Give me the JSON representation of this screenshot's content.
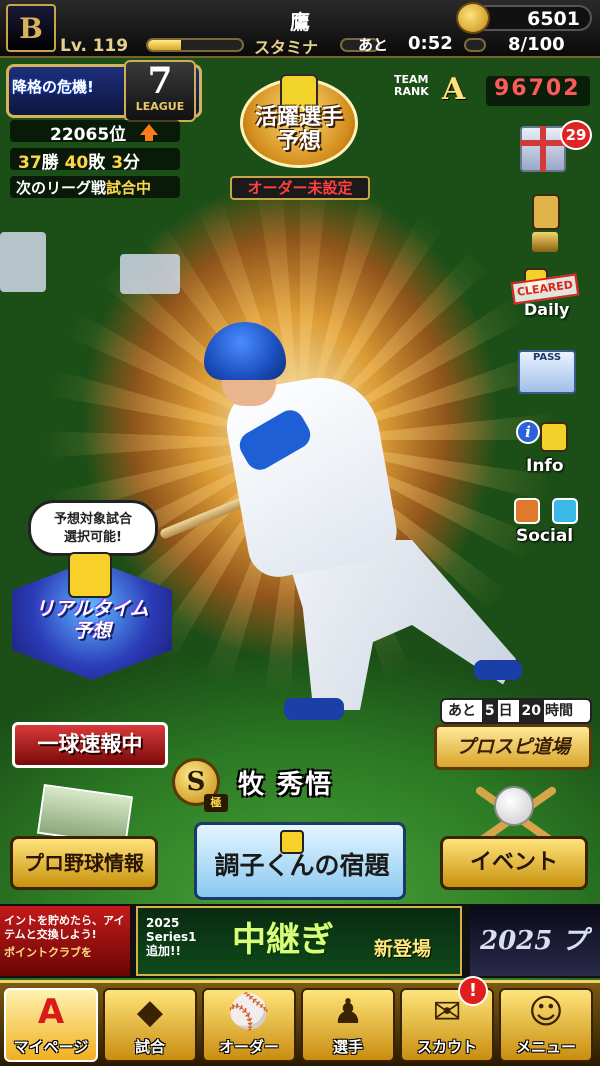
{
  "header": {
    "team_logo": "B",
    "team_name": "鷹",
    "coins": "6501",
    "level_label": "Lv.",
    "level": "119",
    "stamina_label": "スタミナ",
    "stamina_fill": 0.35,
    "time_prefix": "あと",
    "timer": "0:52",
    "stamina_count": "8/100"
  },
  "league": {
    "warning": "降格の危機!",
    "number": "7",
    "word": "LEAGUE",
    "rank": "22065位",
    "wins": "37",
    "wins_unit": "勝",
    "losses": "40",
    "losses_unit": "敗",
    "draws": "3",
    "draws_unit": "分",
    "next_label": "次のリーグ戦",
    "next_status": "試合中"
  },
  "prediction": {
    "title_line1": "活躍選手",
    "title_line2": "予想",
    "order_status": "オーダー未設定"
  },
  "team_rank": {
    "label_line1": "TEAM",
    "label_line2": "RANK",
    "grade": "A",
    "value": "96702"
  },
  "side_menu": {
    "gift_count": "29",
    "cleared_stamp": "CLEARED",
    "daily_label": "Daily",
    "pass_label": "PASS",
    "info_label": "Info",
    "social_label": "Social"
  },
  "realtime": {
    "bubble_line1": "予想対象試合",
    "bubble_line2": "選択可能!",
    "title_line1": "リアルタイム",
    "title_line2": "予想"
  },
  "dojo": {
    "prefix": "あと",
    "days": "5",
    "days_unit": "日",
    "hours": "20",
    "hours_unit": "時間",
    "title": "プロスピ道場"
  },
  "news_button": "一球速報中",
  "player": {
    "rank_letter": "S",
    "rank_sub": "極",
    "name": "牧 秀悟"
  },
  "actions": {
    "pro_info": "プロ野球情報",
    "homework": "調子くんの宿題",
    "event": "イベント"
  },
  "banners": {
    "left_text": "イントを貯めたら、アイテムと交換しよう!",
    "left_sub": "ポイントクラブを",
    "mid_year_line1": "2025",
    "mid_year_line2": "Series1",
    "mid_year_line3": "追加!!",
    "mid_title": "中継ぎ",
    "mid_sub": "新登場",
    "right_text": "2025 プ"
  },
  "nav": {
    "items": [
      {
        "label": "マイページ",
        "glyph": "A"
      },
      {
        "label": "試合",
        "glyph": "◆"
      },
      {
        "label": "オーダー",
        "glyph": "⚾"
      },
      {
        "label": "選手",
        "glyph": "♟"
      },
      {
        "label": "スカウト",
        "glyph": "✉"
      },
      {
        "label": "メニュー",
        "glyph": "☺"
      }
    ],
    "scout_alert": "!"
  },
  "colors": {
    "gold": "#d9a722",
    "alert_red": "#e01e1e",
    "rank_red": "#ff5a5a"
  }
}
